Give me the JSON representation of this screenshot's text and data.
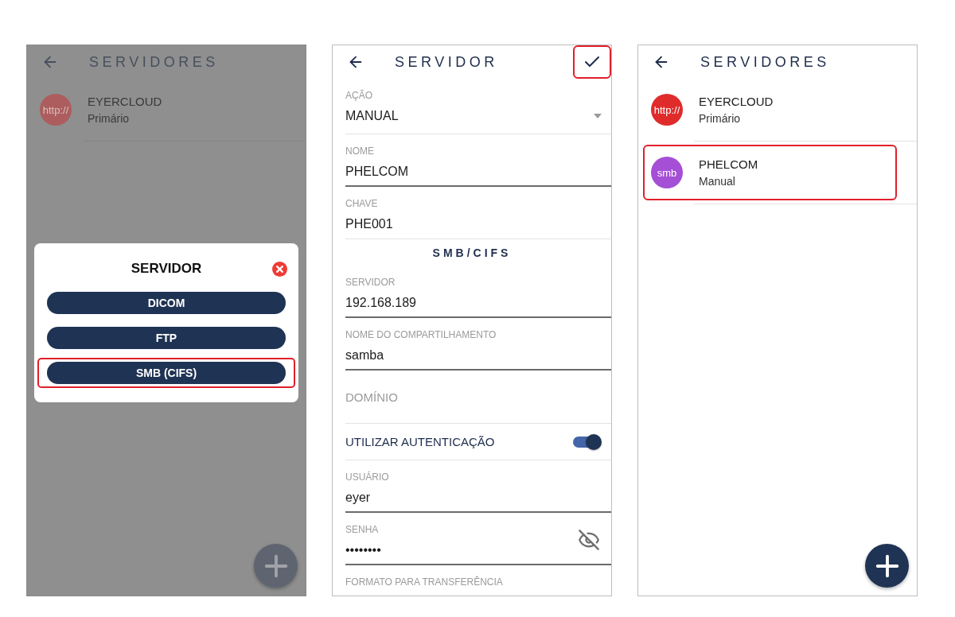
{
  "screens": [
    {
      "kind": "list",
      "title": "SERVIDORES",
      "dimmed": true,
      "servers": [
        {
          "badge": "http://",
          "name": "EYERCLOUD",
          "subtitle": "Primário",
          "color": "#ad5d5d",
          "highlighted": false
        }
      ],
      "dialog": {
        "title": "SERVIDOR",
        "options": [
          {
            "label": "DICOM",
            "highlighted": false
          },
          {
            "label": "FTP",
            "highlighted": false
          },
          {
            "label": "SMB (CIFS)",
            "highlighted": true
          }
        ]
      }
    },
    {
      "kind": "form",
      "title": "SERVIDOR",
      "save_button": {
        "highlighted": true
      },
      "fields": [
        {
          "kind": "select",
          "label": "AÇÃO",
          "value": "MANUAL",
          "underlined": false
        },
        {
          "kind": "text",
          "label": "NOME",
          "value": "PHELCOM",
          "underlined": true
        },
        {
          "kind": "text",
          "label": "CHAVE",
          "value": "PHE001",
          "underlined": false
        },
        {
          "kind": "heading",
          "label": "SMB/CIFS"
        },
        {
          "kind": "text",
          "label": "SERVIDOR",
          "value": "192.168.189",
          "underlined": true
        },
        {
          "kind": "text",
          "label": "NOME DO COMPARTILHAMENTO",
          "value": "samba",
          "underlined": true
        },
        {
          "kind": "empty",
          "placeholder": "DOMÍNIO",
          "underlined": false
        },
        {
          "kind": "switch",
          "label": "UTILIZAR AUTENTICAÇÃO",
          "on": true
        },
        {
          "kind": "text",
          "label": "USUÁRIO",
          "value": "eyer",
          "underlined": true
        },
        {
          "kind": "password",
          "label": "SENHA",
          "value": "••••••••",
          "underlined": true
        },
        {
          "kind": "label",
          "label": "FORMATO PARA TRANSFERÊNCIA"
        }
      ]
    },
    {
      "kind": "list",
      "title": "SERVIDORES",
      "dimmed": false,
      "servers": [
        {
          "badge": "http://",
          "name": "EYERCLOUD",
          "subtitle": "Primário",
          "color": "#e02b2b",
          "highlighted": false
        },
        {
          "badge": "smb",
          "name": "PHELCOM",
          "subtitle": "Manual",
          "color": "#a54fd6",
          "highlighted": true
        }
      ]
    }
  ]
}
